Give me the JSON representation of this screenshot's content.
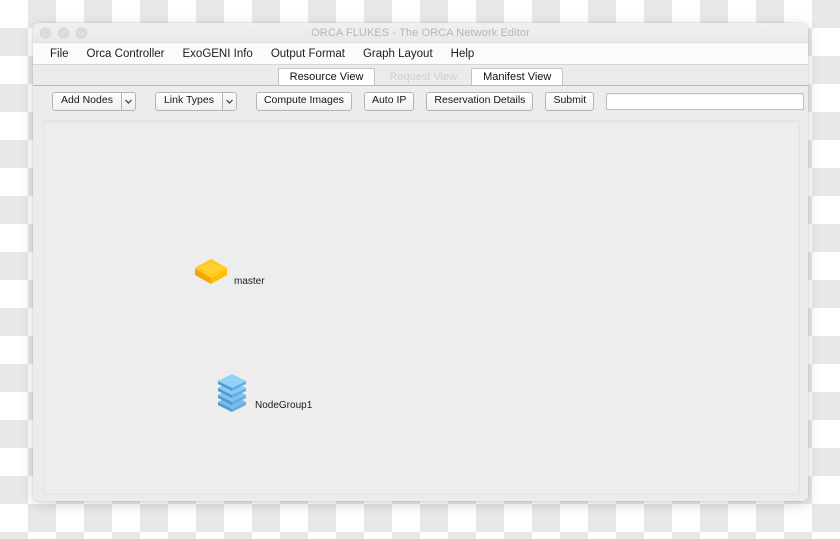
{
  "window": {
    "title": "ORCA FLUKES - The ORCA Network Editor",
    "controls": {
      "close": "close-button",
      "minimize": "minimize-button",
      "zoom": "zoom-button"
    }
  },
  "menubar": {
    "items": [
      {
        "label": "File"
      },
      {
        "label": "Orca Controller"
      },
      {
        "label": "ExoGENI Info"
      },
      {
        "label": "Output Format"
      },
      {
        "label": "Graph Layout"
      },
      {
        "label": "Help"
      }
    ]
  },
  "tabs": [
    {
      "label": "Resource View",
      "state": "selected"
    },
    {
      "label": "Request View",
      "state": "disabled"
    },
    {
      "label": "Manifest View",
      "state": "normal"
    }
  ],
  "toolbar": {
    "add_nodes": "Add Nodes",
    "link_types": "Link Types",
    "compute_images": "Compute Images",
    "auto_ip": "Auto IP",
    "reservation_details": "Reservation Details",
    "submit": "Submit",
    "text_field_value": "",
    "text_field_placeholder": ""
  },
  "canvas": {
    "nodes": [
      {
        "id": "master",
        "label": "master",
        "icon": "single-node-icon",
        "color": "#FFC20E"
      },
      {
        "id": "nodegroup1",
        "label": "NodeGroup1",
        "icon": "node-group-stack-icon",
        "color": "#5BAEE6"
      }
    ]
  },
  "colors": {
    "master_node": "#FFC20E",
    "node_group": "#5BAEE6",
    "canvas_background": "#EDEDED",
    "window_chrome": "#F0F0F0",
    "title_text": "#B6B6B6"
  }
}
